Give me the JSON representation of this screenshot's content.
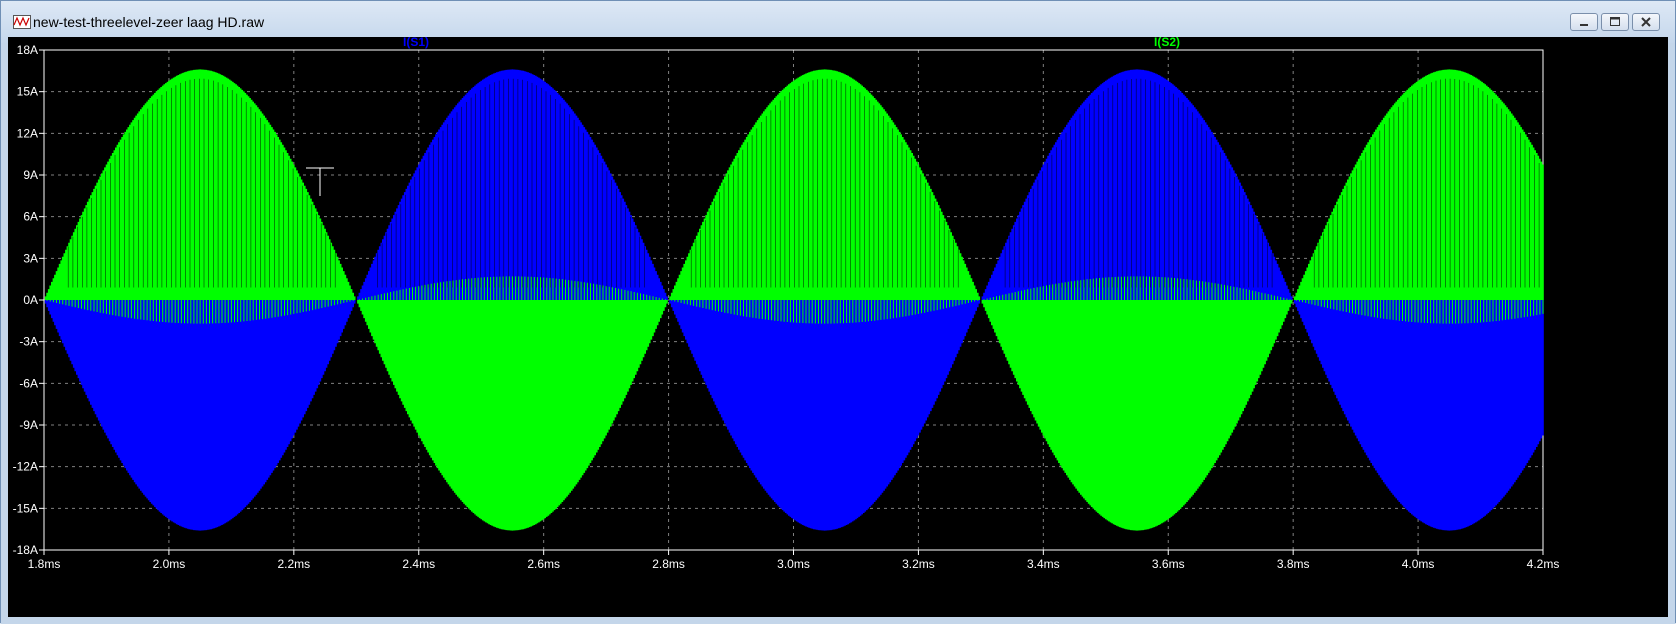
{
  "window": {
    "title": "new-test-threelevel-zeer laag HD.raw"
  },
  "icons": {
    "app": "waveform-app-icon",
    "minimize": "minimize-icon",
    "maximize": "maximize-icon",
    "close": "close-icon",
    "cursor": "crosshair-cursor-icon"
  },
  "colors": {
    "background": "#000000",
    "grid": "#808080",
    "axis_text": "#ffffff",
    "s1": "#0000ff",
    "s2": "#00ff00"
  },
  "chart_data": {
    "type": "line",
    "grid": true,
    "xlim": [
      1.8,
      4.2
    ],
    "ylim": [
      -18,
      18
    ],
    "x_unit": "ms",
    "y_unit": "A",
    "x_ticks": [
      "1.8ms",
      "2.0ms",
      "2.2ms",
      "2.4ms",
      "2.6ms",
      "2.8ms",
      "3.0ms",
      "3.2ms",
      "3.4ms",
      "3.6ms",
      "3.8ms",
      "4.0ms",
      "4.2ms"
    ],
    "y_ticks": [
      "18A",
      "15A",
      "12A",
      "9A",
      "6A",
      "3A",
      "0A",
      "-3A",
      "-6A",
      "-9A",
      "-12A",
      "-15A",
      "-18A"
    ],
    "waveform": {
      "envelope": "sine",
      "period_ms": 1.0,
      "peak_A": 16.6,
      "peak_times_ms": [
        2.05,
        2.55,
        3.05,
        3.55,
        4.05
      ],
      "zero_crossings_ms": [
        1.8,
        2.3,
        2.8,
        3.3,
        3.8
      ],
      "pwm_switching": true,
      "ripple_peak_A": 1.7
    },
    "series": [
      {
        "name": "I(S1)",
        "color": "#0000ff",
        "sign_at_1_8ms": -1
      },
      {
        "name": "I(S2)",
        "color": "#00ff00",
        "sign_at_1_8ms": 1
      }
    ]
  }
}
